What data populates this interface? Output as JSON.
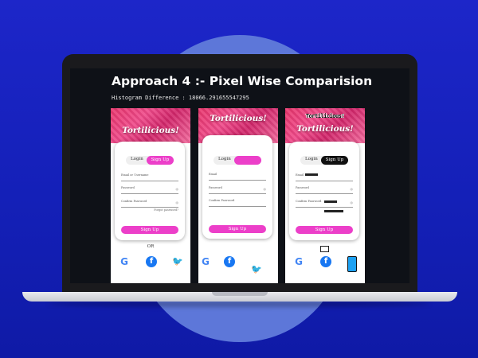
{
  "page": {
    "title": "Approach 4 :- Pixel Wise Comparision",
    "histogram_text": "Histogram Difference : 18066.291655547295"
  },
  "panels": [
    {
      "brand": "Tortilicious!",
      "tab_login": "Login",
      "tab_signup": "Sign Up",
      "field1": "Email or Username",
      "field2": "Password",
      "field3": "Confirm Password",
      "forgot": "Forgot password?",
      "submit": "Sign Up",
      "or": "OR",
      "social": [
        "google-icon",
        "facebook-icon",
        "twitter-icon"
      ]
    },
    {
      "brand": "Tortilicious!",
      "tab_login": "Login",
      "tab_signup": "",
      "field1": "Email",
      "field2": "Password",
      "field3": "Confirm Password",
      "submit": "Sign Up",
      "social": [
        "google-icon",
        "facebook-icon",
        "twitter-icon"
      ]
    },
    {
      "brand": "Tortilicious!",
      "garbled_brand": "Tortilicious!",
      "tab_login": "Login",
      "tab_signup": "Sign Up",
      "field1": "Email",
      "field2": "Password",
      "field3": "Confirm Password",
      "submit": "Sign Up",
      "social": [
        "google-icon",
        "facebook-icon",
        "mobile-icon"
      ]
    }
  ],
  "colors": {
    "background": "#1d26c9",
    "accent_pink": "#ec3fc9",
    "hero_pink": "#e8356c"
  }
}
